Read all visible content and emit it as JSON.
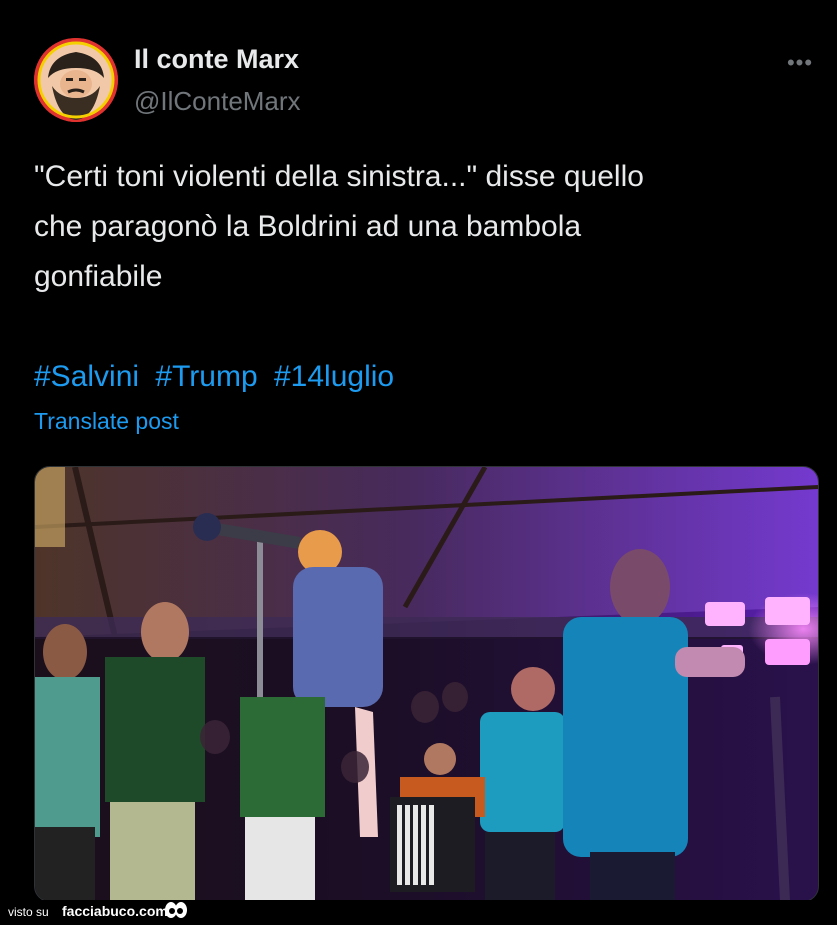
{
  "author": {
    "display_name": "Il conte Marx",
    "handle": "@IlConteMarx",
    "avatar_icon": "bearded-man-portrait-icon"
  },
  "menu": {
    "icon": "more-icon",
    "label": "•••"
  },
  "post": {
    "text_lines": [
      "\"Certi toni violenti della sinistra...\" disse quello",
      "che paragonò la Boldrini ad una bambola",
      "gonfiabile"
    ],
    "hashtags": [
      "#Salvini",
      "#Trump",
      "#14luglio"
    ],
    "translate_label": "Translate post",
    "media_icon": "concert-stage-photo"
  },
  "footer": {
    "visto_label": "visto su",
    "brand": "facciabuco.com",
    "brand_icon": "cartoon-eyes-icon"
  },
  "colors": {
    "background": "#000000",
    "text": "#e7e9ea",
    "muted": "#71767b",
    "link": "#1d9bf0",
    "avatar_ring": "#e0322f"
  }
}
